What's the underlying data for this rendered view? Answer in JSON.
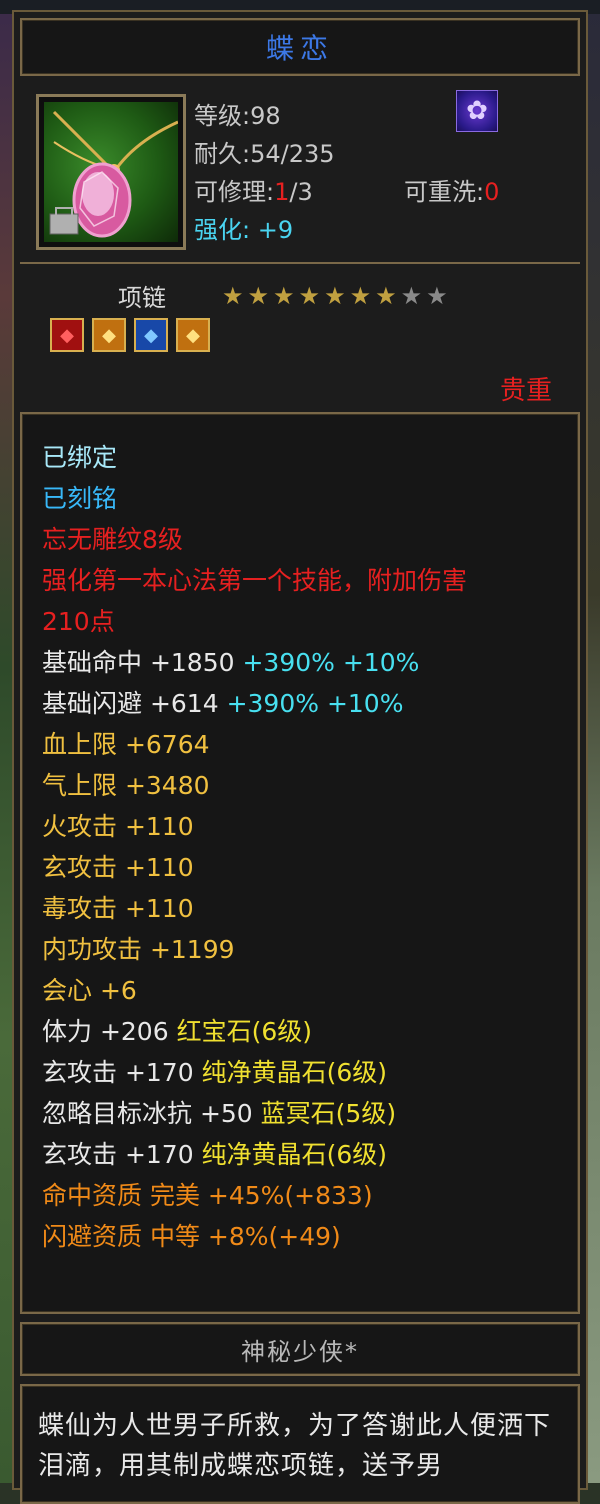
{
  "item": {
    "name": "蝶恋",
    "level": "等级:98",
    "durability": "耐久:54/235",
    "repair_label": "可修理:",
    "repair_current": "1",
    "repair_total": "/3",
    "rewash_label": "可重洗:",
    "rewash_value": "0",
    "enhance_label": "强化: ",
    "enhance_value": "+9",
    "type": "项链",
    "stars_total": 9,
    "stars_filled": 7,
    "rarity": "贵重",
    "zodiac_icon": "butterfly-zodiac-icon",
    "gem_slots": [
      {
        "icon": "red-gem-icon",
        "color": "#d81818"
      },
      {
        "icon": "yellow-gem-icon",
        "color": "#f0a020"
      },
      {
        "icon": "blue-gem-icon",
        "color": "#2878e8"
      },
      {
        "icon": "yellow-gem-icon",
        "color": "#f0a020"
      }
    ]
  },
  "attributes": {
    "bound": "已绑定",
    "engraved": "已刻铭",
    "pattern": "忘无雕纹8级",
    "skill_bonus_1": "强化第一本心法第一个技能，附加伤害",
    "skill_bonus_2": "210点",
    "hit_label": "基础命中 +1850",
    "hit_bonus": "+390% +10%",
    "dodge_label": "基础闪避 +614",
    "dodge_bonus": "+390% +10%",
    "hp": "血上限 +6764",
    "mp": "气上限 +3480",
    "fire_atk": "火攻击 +110",
    "mystic_atk": "玄攻击 +110",
    "poison_atk": "毒攻击 +110",
    "inner_atk": "内功攻击 +1199",
    "crit": "会心 +6",
    "gem1_stat": "体力 +206",
    "gem1_name": "红宝石(6级)",
    "gem2_stat": "玄攻击 +170",
    "gem2_name": "纯净黄晶石(6级)",
    "gem3_stat": "忽略目标冰抗 +50",
    "gem3_name": "蓝冥石(5级)",
    "gem4_stat": "玄攻击 +170",
    "gem4_name": "纯净黄晶石(6级)",
    "hit_quality": "命中资质   完美",
    "hit_quality_val": "+45%(+833)",
    "dodge_quality": "闪避资质   中等",
    "dodge_quality_val": "+8%(+49)"
  },
  "author": "神秘少侠*",
  "description": "蝶仙为人世男子所救，为了答谢此人便洒下泪滴，用其制成蝶恋项链，送予男"
}
